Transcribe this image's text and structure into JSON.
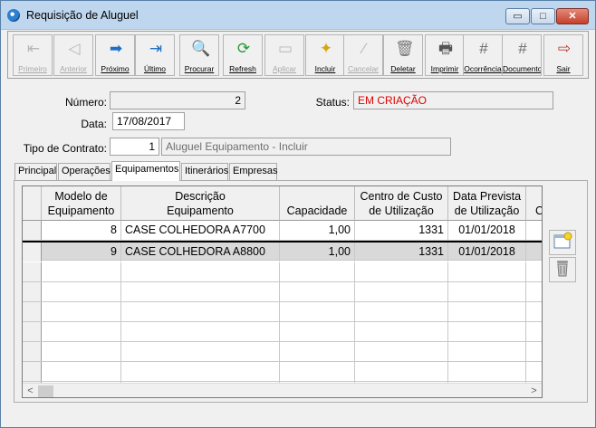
{
  "window": {
    "title": "Requisição de Aluguel",
    "controls": {
      "minimize": "▭",
      "maximize": "□",
      "close": "✕"
    }
  },
  "toolbar": {
    "buttons": [
      {
        "label": "Primeiro",
        "icon": "first-icon",
        "glyph": "⇤",
        "enabled": false
      },
      {
        "label": "Anterior",
        "icon": "prev-icon",
        "glyph": "◁",
        "enabled": false
      },
      {
        "label": "Próximo",
        "icon": "next-arrow-icon",
        "glyph": "➡",
        "enabled": true
      },
      {
        "label": "Último",
        "icon": "last-icon",
        "glyph": "⇥",
        "enabled": true
      },
      {
        "label": "Procurar",
        "icon": "search-icon",
        "glyph": "🔍",
        "enabled": true
      },
      {
        "label": "Refresh",
        "icon": "refresh-icon",
        "glyph": "⟳",
        "enabled": true
      },
      {
        "label": "Aplicar",
        "icon": "apply-icon",
        "glyph": "▭",
        "enabled": false
      },
      {
        "label": "Incluir",
        "icon": "new-record-icon",
        "glyph": "✦",
        "enabled": true
      },
      {
        "label": "Cancelar",
        "icon": "cancel-icon",
        "glyph": "⁄",
        "enabled": false
      },
      {
        "label": "Deletar",
        "icon": "trash-icon",
        "glyph": "🗑",
        "enabled": true
      },
      {
        "label": "Imprimir",
        "icon": "printer-icon",
        "glyph": "🖶",
        "enabled": true
      },
      {
        "label": "Ocorrência",
        "icon": "grid-icon",
        "glyph": "#",
        "enabled": true
      },
      {
        "label": "Documento",
        "icon": "grid-icon",
        "glyph": "#",
        "enabled": true
      },
      {
        "label": "Sair",
        "icon": "exit-door-icon",
        "glyph": "⇨",
        "enabled": true
      }
    ]
  },
  "form": {
    "numero_label": "Número:",
    "numero_value": "2",
    "status_label": "Status:",
    "status_value": "EM CRIAÇÃO",
    "status_color": "#e00000",
    "data_label": "Data:",
    "data_value": "17/08/2017",
    "tipo_label": "Tipo de Contrato:",
    "tipo_code": "1",
    "tipo_desc": "Aluguel Equipamento - Incluir"
  },
  "tabs": [
    "Principal",
    "Operações",
    "Equipamentos",
    "Itinerários",
    "Empresas"
  ],
  "active_tab": "Equipamentos",
  "grid": {
    "headers": [
      {
        "line1": "Modelo de",
        "line2": "Equipamento"
      },
      {
        "line1": "Descrição",
        "line2": "Equipamento"
      },
      {
        "line1": "",
        "line2": "Capacidade"
      },
      {
        "line1": "Centro de Custo",
        "line2": "de Utilização"
      },
      {
        "line1": "Data Prevista",
        "line2": "de Utilização"
      },
      {
        "line1": "",
        "line2": "C"
      }
    ],
    "rows": [
      [
        "8",
        "CASE COLHEDORA  A7700",
        "1,00",
        "1331",
        "01/01/2018",
        ""
      ],
      [
        "9",
        "CASE COLHEDORA  A8800",
        "1,00",
        "1331",
        "01/01/2018",
        ""
      ]
    ],
    "selected_row": 1,
    "empty_rows": 7,
    "scroll": {
      "left": "<",
      "right": ">"
    }
  },
  "side_buttons": [
    {
      "icon": "new-record-icon",
      "glyph": "✦"
    },
    {
      "icon": "trash-icon",
      "glyph": "🗑"
    }
  ]
}
